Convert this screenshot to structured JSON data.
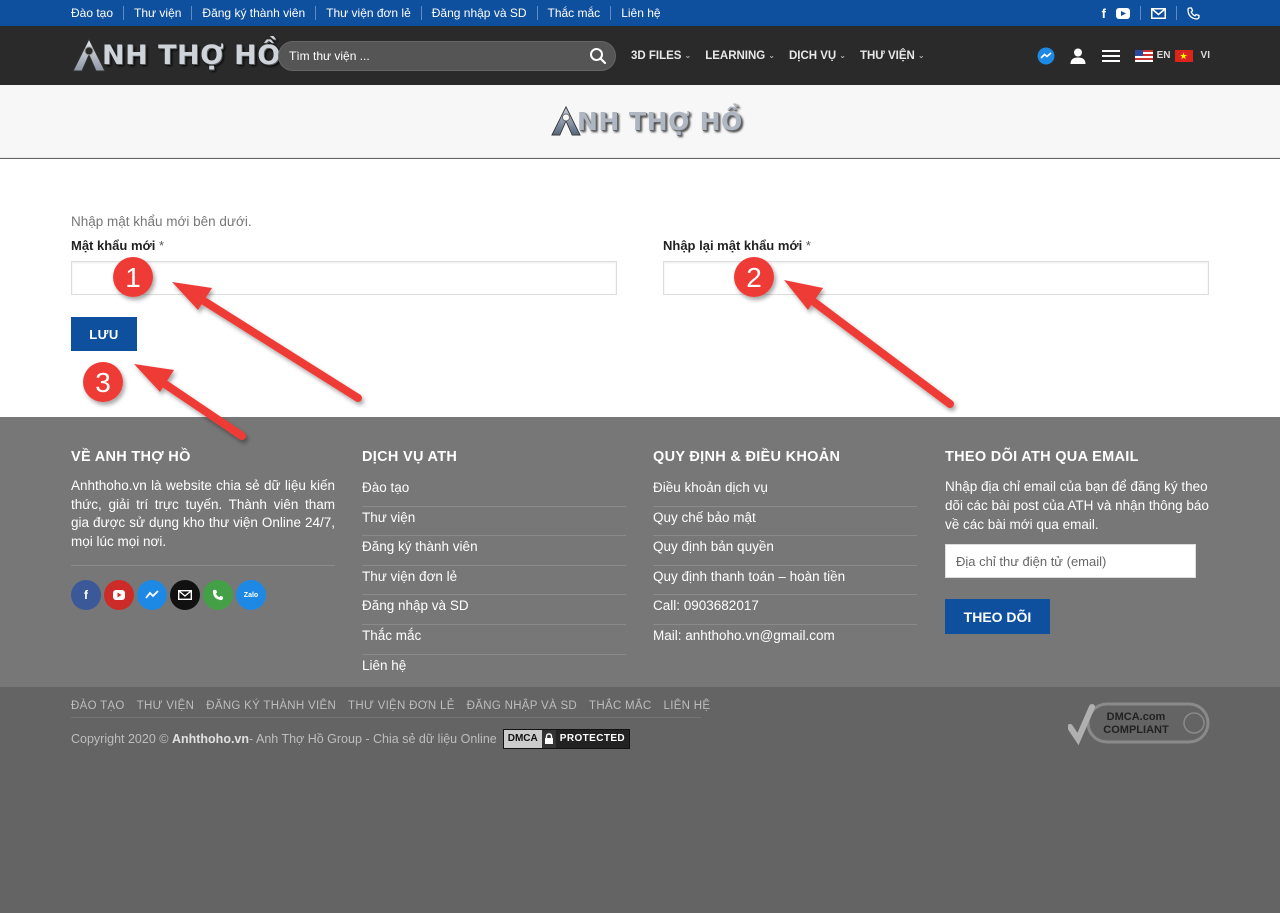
{
  "topbar": {
    "links": [
      "Đào tạo",
      "Thư viện",
      "Đăng ký thành viên",
      "Thư viện đơn lẻ",
      "Đăng nhập và SD",
      "Thắc mắc",
      "Liên hệ"
    ],
    "icons": [
      "facebook-icon",
      "youtube-icon",
      "email-icon",
      "phone-icon"
    ]
  },
  "header": {
    "logo_text": "NH THỢ HỒ",
    "search_placeholder": "Tìm thư viện ...",
    "nav": [
      "3D FILES",
      "LEARNING",
      "DỊCH VỤ",
      "THƯ VIỆN"
    ],
    "lang_en": "EN",
    "lang_vi": "VI"
  },
  "band": {
    "logo_text": "NH THỢ HỒ"
  },
  "form": {
    "intro": "Nhập mật khẩu mới bên dưới.",
    "new_password_label": "Mật khẩu mới",
    "confirm_password_label": "Nhập lại mật khẩu mới",
    "required_mark": "*",
    "save_label": "LƯU"
  },
  "annotations": {
    "badges": [
      "1",
      "2",
      "3"
    ],
    "color": "#e53935"
  },
  "footer": {
    "about": {
      "title": "VỀ ANH THỢ HỒ",
      "text": "Anhthoho.vn là website chia sẻ dữ liệu kiến thức, giải trí trực tuyến. Thành viên tham gia được sử dụng kho thư viện Online 24/7, mọi lúc mọi nơi."
    },
    "services": {
      "title": "DỊCH VỤ ATH",
      "items": [
        "Đào tạo",
        "Thư viện",
        "Đăng ký thành viên",
        "Thư viện đơn lẻ",
        "Đăng nhập và SD",
        "Thắc mắc",
        "Liên hệ"
      ]
    },
    "terms": {
      "title": "QUY ĐỊNH & ĐIỀU KHOẢN",
      "items": [
        "Điều khoản dịch vụ",
        "Quy chế bảo mật",
        "Quy định bản quyền",
        "Quy định thanh toán – hoàn tiền",
        "Call: 0903682017",
        "Mail: anhthoho.vn@gmail.com"
      ]
    },
    "subscribe": {
      "title": "THEO DÕI ATH QUA EMAIL",
      "text": "Nhập địa chỉ email của bạn để đăng ký theo dõi các bài post của ATH và nhận thông báo về các bài mới qua email.",
      "placeholder": "Địa chỉ thư điện tử (email)",
      "button": "THEO DÕI"
    },
    "social_zalo": "Zalo"
  },
  "bottom": {
    "links": [
      "ĐÀO TẠO",
      "THƯ VIỆN",
      "ĐĂNG KÝ THÀNH VIÊN",
      "THƯ VIỆN ĐƠN LẺ",
      "ĐĂNG NHẬP VÀ SD",
      "THẮC MẮC",
      "LIÊN HỆ"
    ],
    "copyright_prefix": "Copyright 2020 ©",
    "site": "Anhthoho.vn",
    "copyright_suffix": " - Anh Thợ Hồ Group - Chia sẻ dữ liệu Online",
    "dmca_left": "DMCA",
    "dmca_right": "PROTECTED",
    "compliant_top": "DMCA.com",
    "compliant_bottom": "COMPLIANT"
  },
  "colors": {
    "brand_blue": "#0e4f9e",
    "header_dark": "#2a2a2a",
    "footer": "#777777",
    "bottom": "#646464"
  }
}
